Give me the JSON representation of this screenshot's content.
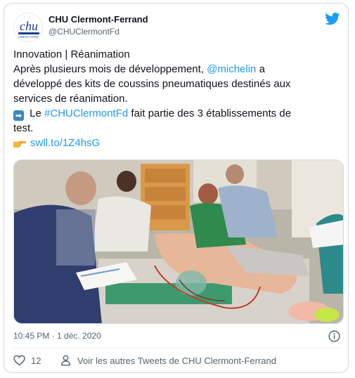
{
  "account": {
    "name": "CHU Clermont-Ferrand",
    "handle": "@CHUClermontFd",
    "avatar_text": "chu",
    "avatar_subtext": "CLERMONT-FERRAND"
  },
  "tweet": {
    "line1": "Innovation | Réanimation",
    "line2_before": "Après plusieurs mois de développement, ",
    "line2_mention": "@michelin",
    "line2_after": " a",
    "line3": "développé des kits de coussins pneumatiques destinés aux",
    "line4": "services de réanimation.",
    "line5_prefix": "➡",
    "line5_before": " Le ",
    "line5_hashtag": "#CHUClermontFd",
    "line5_after": " fait partie des 3 établissements de",
    "line6": "test.",
    "link": "swll.to/1Z4hsG"
  },
  "meta": {
    "timestamp": "10:45 PM · 1 déc. 2020",
    "like_count": "12",
    "more_tweets": "Voir les autres Tweets de CHU Clermont-Ferrand"
  },
  "colors": {
    "link": "#1d9bf0",
    "twitter_blue": "#1d9bf0",
    "text": "#0f1419",
    "muted": "#536471",
    "border": "#cfd9de"
  }
}
